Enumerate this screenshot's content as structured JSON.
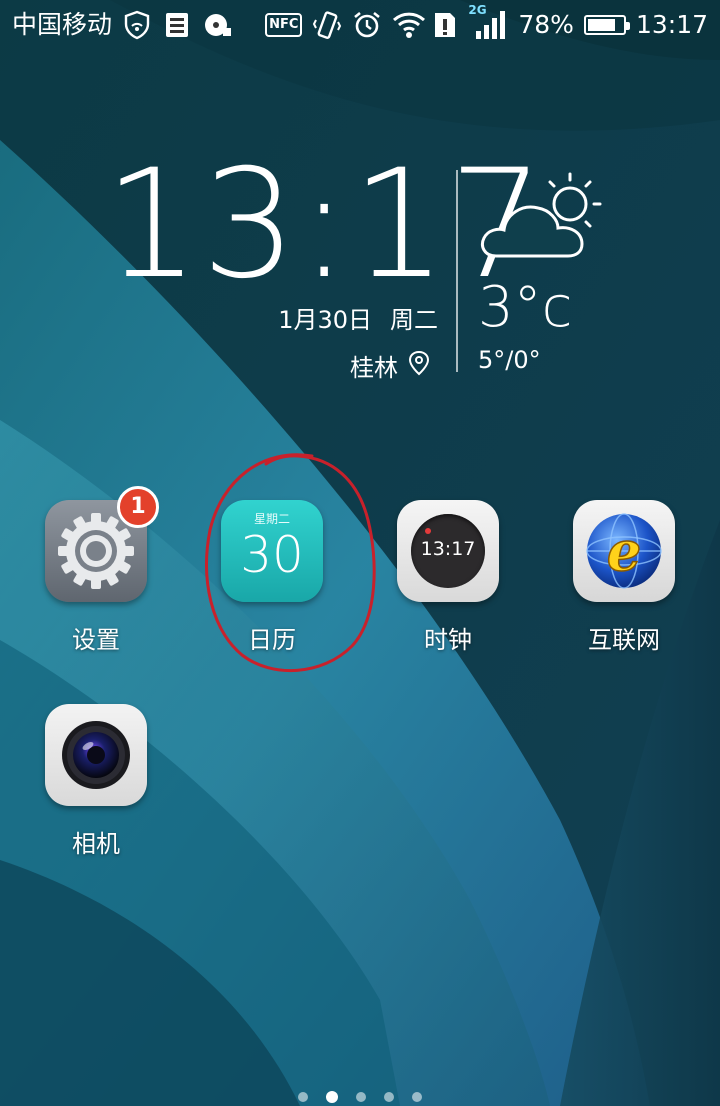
{
  "status_bar": {
    "carrier": "中国移动",
    "nfc_label": "NFC",
    "network_type": "2G",
    "battery_percent_text": "78%",
    "battery_level": 0.78,
    "time": "13:17",
    "icons": [
      "wifi-shield-icon",
      "sim-card-icon",
      "media-icon",
      "nfc-icon",
      "vibrate-icon",
      "alarm-icon",
      "wifi-icon",
      "storage-alert-icon",
      "signal-icon",
      "battery-icon"
    ]
  },
  "clock_widget": {
    "time": "13:17",
    "date": "1月30日",
    "weekday": "周二",
    "city": "桂林",
    "temperature": "3°c",
    "temp_range": "5°/0°",
    "weather_icon": "partly-cloudy-icon"
  },
  "apps": [
    {
      "label": "设置",
      "icon": "settings-icon",
      "badge": "1"
    },
    {
      "label": "日历",
      "icon": "calendar-icon",
      "weekday": "星期二",
      "day": "30"
    },
    {
      "label": "时钟",
      "icon": "clock-icon",
      "time": "13:17"
    },
    {
      "label": "互联网",
      "icon": "browser-icon"
    },
    {
      "label": "相机",
      "icon": "camera-icon"
    }
  ],
  "annotation": {
    "type": "red-hand-drawn-circle",
    "color": "#c8212b",
    "target": "日历"
  },
  "pager": {
    "pages": 5,
    "active_index": 1
  },
  "colors": {
    "badge": "#e3412b",
    "calendar_tile": "#22bfbe",
    "annotation": "#c8212b"
  }
}
